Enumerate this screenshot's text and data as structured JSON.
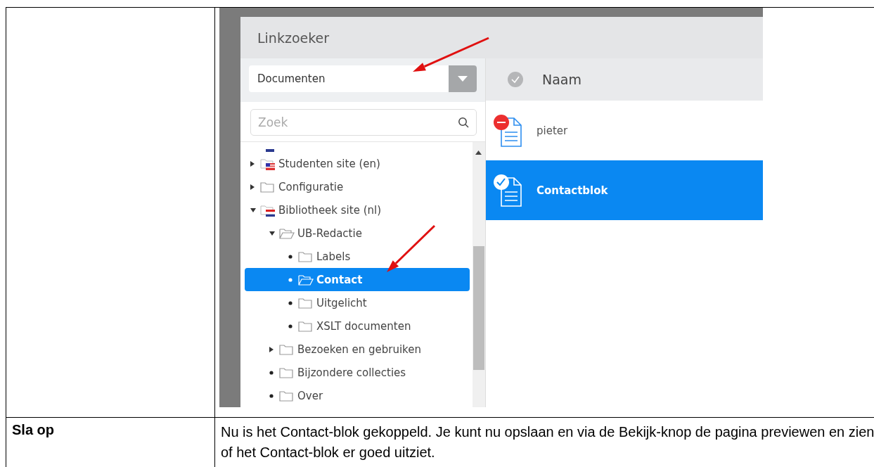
{
  "document_table": {
    "rows": [
      {
        "label": "",
        "kind": "screenshot"
      },
      {
        "label": "Sla op",
        "kind": "text",
        "text": "Nu is het Contact-blok gekoppeld. Je kunt nu opslaan en via de Bekijk-knop de pagina previewen en zien of het Contact-blok er goed uitziet."
      }
    ]
  },
  "dialog": {
    "title": "Linkzoeker",
    "source_select": {
      "value": "Documenten"
    },
    "search": {
      "placeholder": "Zoek"
    },
    "tree": {
      "items": [
        {
          "label": "Studenten site (en)",
          "kind": "usfolder",
          "expanded": false,
          "selected": false
        },
        {
          "label": "Configuratie",
          "kind": "folder",
          "expanded": false,
          "selected": false
        },
        {
          "label": "Bibliotheek site (nl)",
          "kind": "nlfolder",
          "expanded": true,
          "selected": false,
          "children": [
            {
              "label": "UB-Redactie",
              "kind": "folder",
              "expanded": true,
              "selected": false,
              "children": [
                {
                  "label": "Labels",
                  "kind": "folder",
                  "selected": false
                },
                {
                  "label": "Contact",
                  "kind": "folder",
                  "selected": true
                },
                {
                  "label": "Uitgelicht",
                  "kind": "folder",
                  "selected": false
                },
                {
                  "label": "XSLT documenten",
                  "kind": "folder",
                  "selected": false
                }
              ]
            },
            {
              "label": "Bezoeken en gebruiken",
              "kind": "folder",
              "expanded": false,
              "selected": false
            },
            {
              "label": "Bijzondere collecties",
              "kind": "folder",
              "selected": false
            },
            {
              "label": "Over",
              "kind": "folder",
              "selected": false
            }
          ]
        }
      ]
    },
    "files": {
      "columns": [
        "Naam"
      ],
      "rows": [
        {
          "name": "pieter",
          "kind": "blocked",
          "selected": false
        },
        {
          "name": "Contactblok",
          "kind": "checked",
          "selected": true
        }
      ]
    }
  }
}
